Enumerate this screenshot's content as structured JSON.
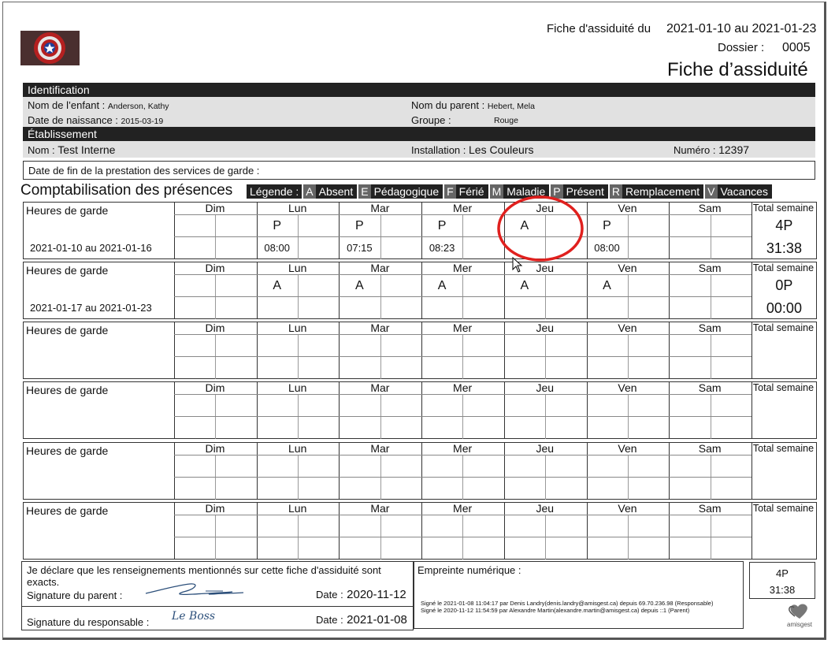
{
  "header": {
    "period_label": "Fiche d'assiduité du",
    "period_value": "2021-01-10 au 2021-01-23",
    "dossier_label": "Dossier :",
    "dossier_value": "0005",
    "title": "Fiche d’assiduité"
  },
  "identification": {
    "section_title": "Identification",
    "child_label": "Nom de l’enfant :",
    "child_value": "Anderson, Kathy",
    "dob_label": "Date de naissance :",
    "dob_value": "2015-03-19",
    "parent_label": "Nom du parent :",
    "parent_value": "Hebert, Mela",
    "group_label": "Groupe :",
    "group_value": "Rouge"
  },
  "etablissement": {
    "section_title": "Établissement",
    "name_label": "Nom :",
    "name_value": "Test Interne",
    "install_label": "Installation :",
    "install_value": "Les Couleurs",
    "number_label": "Numéro :",
    "number_value": "12397",
    "end_date_label": "Date de fin de la prestation des services de garde :"
  },
  "presences": {
    "title": "Comptabilisation des présences",
    "legend_label": "Légende :",
    "legend": [
      {
        "key": "A",
        "label": "Absent"
      },
      {
        "key": "E",
        "label": "Pédagogique"
      },
      {
        "key": "F",
        "label": "Férié"
      },
      {
        "key": "M",
        "label": "Maladie"
      },
      {
        "key": "P",
        "label": "Présent"
      },
      {
        "key": "R",
        "label": "Remplacement"
      },
      {
        "key": "V",
        "label": "Vacances"
      }
    ],
    "row_label": "Heures de garde",
    "total_label": "Total semaine",
    "days": [
      "Dim",
      "Lun",
      "Mar",
      "Mer",
      "Jeu",
      "Ven",
      "Sam"
    ],
    "weeks": [
      {
        "range": "2021-01-10 au 2021-01-16",
        "marks": [
          "",
          "P",
          "P",
          "P",
          "A",
          "P",
          ""
        ],
        "times": [
          "",
          "08:00",
          "07:15",
          "08:23",
          "",
          "08:00",
          ""
        ],
        "total_count": "4P",
        "total_hours": "31:38"
      },
      {
        "range": "2021-01-17 au 2021-01-23",
        "marks": [
          "",
          "A",
          "A",
          "A",
          "A",
          "A",
          ""
        ],
        "times": [
          "",
          "",
          "",
          "",
          "",
          "",
          ""
        ],
        "total_count": "0P",
        "total_hours": "00:00"
      },
      {
        "range": "",
        "marks": [
          "",
          "",
          "",
          "",
          "",
          "",
          ""
        ],
        "times": [
          "",
          "",
          "",
          "",
          "",
          "",
          ""
        ],
        "total_count": "",
        "total_hours": ""
      },
      {
        "range": "",
        "marks": [
          "",
          "",
          "",
          "",
          "",
          "",
          ""
        ],
        "times": [
          "",
          "",
          "",
          "",
          "",
          "",
          ""
        ],
        "total_count": "",
        "total_hours": ""
      },
      {
        "range": "",
        "marks": [
          "",
          "",
          "",
          "",
          "",
          "",
          ""
        ],
        "times": [
          "",
          "",
          "",
          "",
          "",
          "",
          ""
        ],
        "total_count": "",
        "total_hours": ""
      },
      {
        "range": "",
        "marks": [
          "",
          "",
          "",
          "",
          "",
          "",
          ""
        ],
        "times": [
          "",
          "",
          "",
          "",
          "",
          "",
          ""
        ],
        "total_count": "",
        "total_hours": ""
      }
    ]
  },
  "footer": {
    "declaration": "Je déclare que les renseignements mentionnés sur cette fiche d'assiduité sont exacts.",
    "parent_sig_label": "Signature du parent :",
    "parent_date_label": "Date :",
    "parent_date_value": "2020-11-12",
    "resp_sig_label": "Signature du responsable :",
    "resp_sig_text": "Le Boss",
    "resp_date_label": "Date :",
    "resp_date_value": "2021-01-08",
    "fingerprint_label": "Empreinte numérique :",
    "sig_line_1": "Signé le 2021-01-08 11:04:17 par Denis Landry(denis.landry@amisgest.ca) depuis 69.70.236.98 (Responsable)",
    "sig_line_2": "Signé le 2020-11-12 11:54:59 par Alexandre Martin(alexandre.martin@amisgest.ca) depuis ::1 (Parent)",
    "summary_count": "4P",
    "summary_hours": "31:38",
    "brand": "amisgest"
  },
  "annotation": {
    "circle_color": "#e0201e"
  }
}
